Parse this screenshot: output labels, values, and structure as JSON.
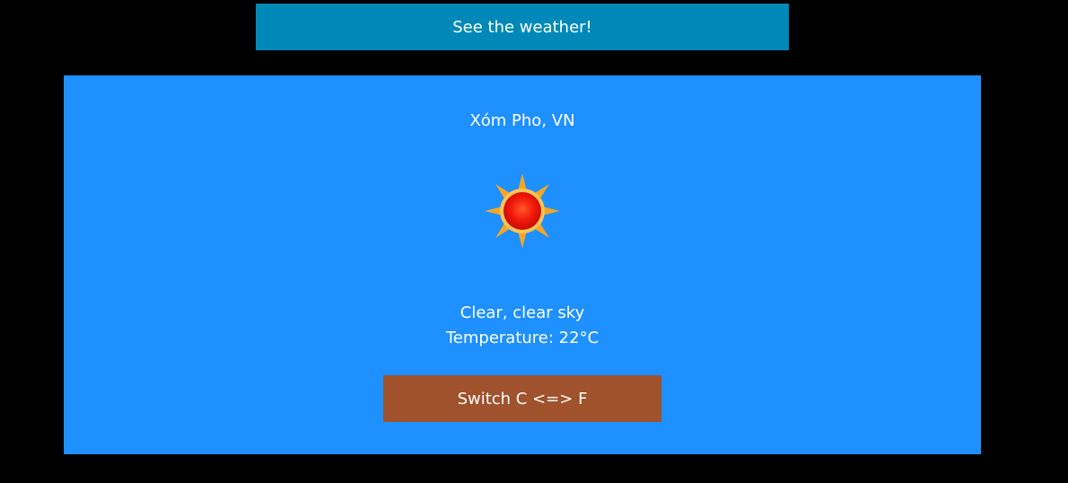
{
  "header": {
    "button_label": "See the weather!"
  },
  "weather": {
    "location": "Xóm Pho, VN",
    "icon": "sun-icon",
    "description": "Clear, clear sky",
    "temperature_text": "Temperature: 22°C",
    "switch_label": "Switch C <=> F"
  },
  "colors": {
    "background": "#000000",
    "header_button": "#0089B8",
    "card": "#1E90FF",
    "switch_button": "#A0522D",
    "text": "#FFFFFF"
  }
}
